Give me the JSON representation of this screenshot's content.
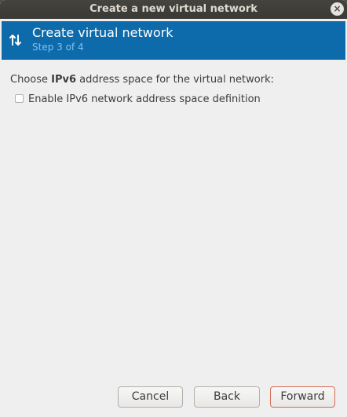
{
  "window": {
    "title": "Create a new virtual network",
    "close_symbol": "×"
  },
  "header": {
    "icon": "network-arrows-icon",
    "title": "Create virtual network",
    "step": "Step 3 of 4"
  },
  "content": {
    "prompt_prefix": "Choose ",
    "prompt_bold": "IPv6",
    "prompt_suffix": " address space for the virtual network:",
    "ipv6_checkbox": {
      "label": "Enable IPv6 network address space definition",
      "checked": false
    }
  },
  "buttons": {
    "cancel": "Cancel",
    "back": "Back",
    "forward": "Forward"
  },
  "colors": {
    "header_bg": "#0e6bab",
    "step_text": "#7ec1ee",
    "forward_border": "#d06d55"
  }
}
